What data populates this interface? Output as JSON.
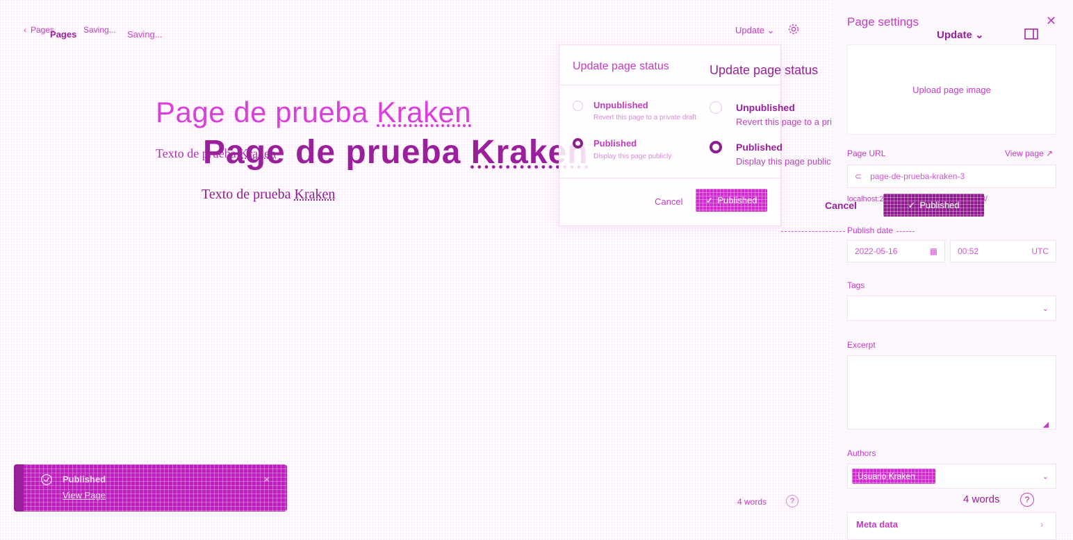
{
  "topbar": {
    "breadcrumb": "Pages",
    "breadcrumb_shadow": "Pages",
    "saving": "Saving...",
    "saving_shadow": "Saving...",
    "update_label": "Update",
    "settings_icon": "gear-icon"
  },
  "editor": {
    "title_faint": {
      "prefix": "Page de prueba ",
      "accent": "Kraken"
    },
    "title_bold": {
      "prefix": "Page de prueba ",
      "accent": "Kraken"
    },
    "body_faint": {
      "prefix": "Texto de prueba ",
      "accent": "Kraken"
    },
    "body_bold": {
      "prefix": "Texto de prueba ",
      "accent": "Kraken"
    }
  },
  "status_popover": {
    "title": "Update page status",
    "title_shadow": "Update page status",
    "options": [
      {
        "label": "Unpublished",
        "description": "Revert this page to a private draft",
        "selected": false
      },
      {
        "label": "Published",
        "description": "Display this page publicly",
        "selected": true
      }
    ],
    "cancel_label": "Cancel",
    "confirm_label": "Published",
    "cancel_label_shadow": "Cancel",
    "confirm_label_shadow": "Published"
  },
  "settings": {
    "title": "Page settings",
    "update_label": "Update",
    "upload_label": "Upload page image",
    "url_label": "Page URL",
    "view_page_label": "View page ↗",
    "url_value": "page-de-prueba-kraken-3",
    "url_full": "localhost:2368/page-de-prueba-kraken-3/",
    "publish_date_label": "Publish date",
    "date_value": "2022-05-16",
    "time_value": "00:52",
    "timezone": "UTC",
    "tags_label": "Tags",
    "excerpt_label": "Excerpt",
    "authors_label": "Authors",
    "author_name": "Usuario Kraken",
    "meta_label": "Meta data"
  },
  "wordcount": {
    "value": "4 words",
    "value_shadow": "4 words",
    "help_glyph": "?"
  },
  "toast": {
    "title": "Published",
    "link": "View Page",
    "close_glyph": "×"
  },
  "colors": {
    "accent": "#d12ad1",
    "accent_dark": "#8e1c8e"
  }
}
